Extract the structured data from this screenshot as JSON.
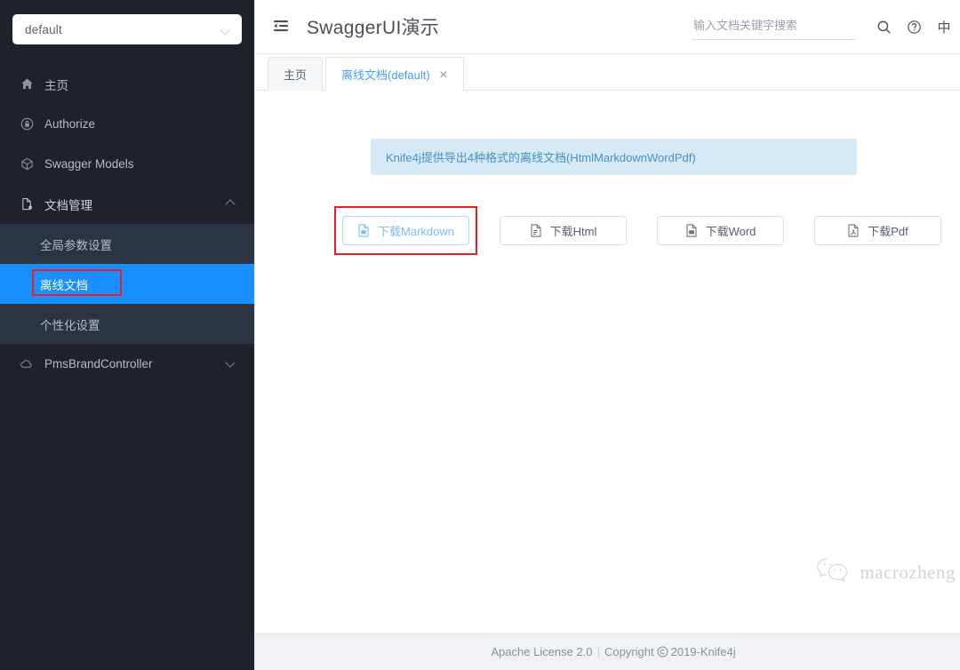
{
  "sidebar": {
    "group_select": {
      "value": "default",
      "icon": "chevron-down-icon"
    },
    "items": [
      {
        "label": "主页",
        "icon": "home-icon"
      },
      {
        "label": "Authorize",
        "icon": "lock-icon"
      },
      {
        "label": "Swagger Models",
        "icon": "cube-icon"
      },
      {
        "label": "文档管理",
        "icon": "file-settings-icon",
        "expanded": true,
        "arrow": "chevron-up-icon"
      }
    ],
    "submenu": [
      {
        "label": "全局参数设置",
        "active": false
      },
      {
        "label": "离线文档",
        "active": true,
        "highlighted": true
      },
      {
        "label": "个性化设置",
        "active": false
      }
    ],
    "controller": {
      "label": "PmsBrandController",
      "icon": "cloud-icon",
      "arrow": "chevron-down-icon"
    }
  },
  "header": {
    "fold_icon": "menu-fold-icon",
    "title": "SwaggerUI演示",
    "search": {
      "placeholder": "输入文档关键字搜索",
      "value": ""
    },
    "search_icon": "search-icon",
    "help_icon": "question-circle-icon",
    "lang_label": "中"
  },
  "tabs": [
    {
      "label": "主页",
      "active": false,
      "closable": false
    },
    {
      "label": "离线文档(default)",
      "active": true,
      "closable": true,
      "close_glyph": "✕"
    }
  ],
  "content": {
    "alert": "Knife4j提供导出4种格式的离线文档(HtmlMarkdownWordPdf)",
    "buttons": [
      {
        "label": "下载Markdown",
        "icon": "file-markdown-icon",
        "primary": true,
        "highlighted": true
      },
      {
        "label": "下载Html",
        "icon": "file-html-icon",
        "primary": false,
        "highlighted": false
      },
      {
        "label": "下载Word",
        "icon": "file-word-icon",
        "primary": false,
        "highlighted": false
      },
      {
        "label": "下载Pdf",
        "icon": "file-pdf-icon",
        "primary": false,
        "highlighted": false
      }
    ]
  },
  "footer": {
    "license": "Apache License 2.0",
    "separator": "|",
    "copyright_prefix": "Copyright",
    "copyright_icon": "copyright-icon",
    "copyright_text": "2019-Knife4j"
  },
  "watermark": {
    "icon": "wechat-icon",
    "text": "macrozheng"
  },
  "colors": {
    "sidebar_bg": "#20222b",
    "submenu_bg": "#2b3443",
    "accent_blue": "#1890ff",
    "tab_active_text": "#409eff",
    "alert_bg": "#d5eaf6",
    "alert_text": "#4a90c4",
    "annotation_red": "#ee1c25",
    "footer_bg": "#f0f2f5"
  }
}
